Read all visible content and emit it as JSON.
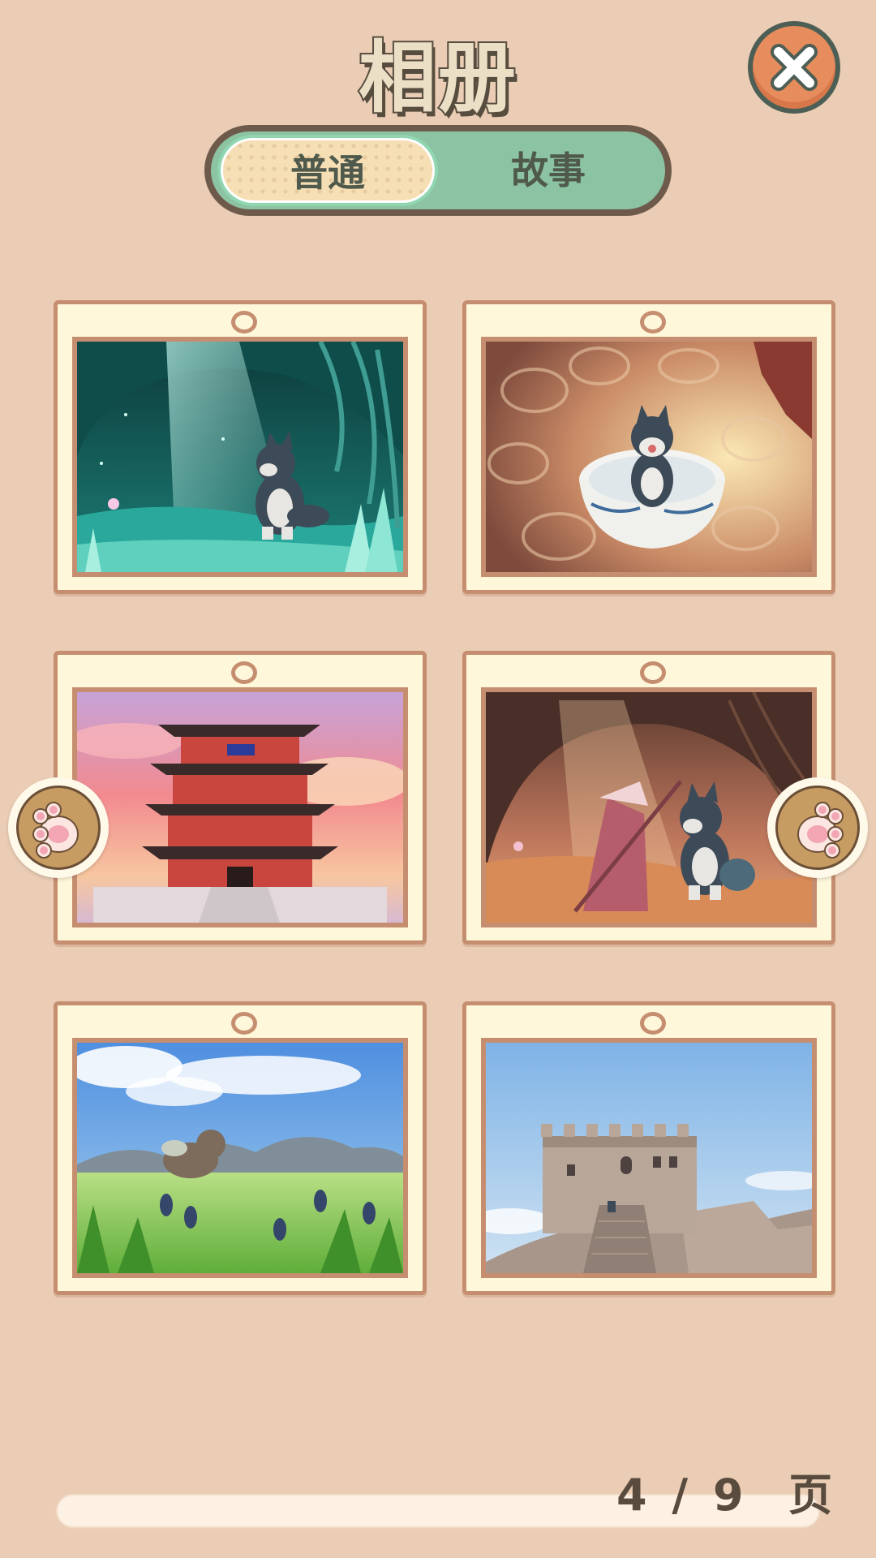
{
  "header": {
    "title": "相册"
  },
  "close_button": {
    "icon": "close-icon"
  },
  "tabs": [
    {
      "label": "普通",
      "selected": true
    },
    {
      "label": "故事",
      "selected": false
    }
  ],
  "photos": [
    {
      "scene": "cave-teal"
    },
    {
      "scene": "bowl"
    },
    {
      "scene": "pavilion"
    },
    {
      "scene": "cave-warrior"
    },
    {
      "scene": "meadow"
    },
    {
      "scene": "great-wall"
    }
  ],
  "nav": {
    "prev_icon": "paw-left-icon",
    "next_icon": "paw-right-icon"
  },
  "pagination": {
    "current": "4",
    "separator": "/",
    "total": "9",
    "unit": "页"
  },
  "colors": {
    "background": "#ebcdb5",
    "tab_bar": "#8cc3a2",
    "tab_selected": "#f6dfb5",
    "frame": "#fff7da",
    "frame_border": "#c68e70",
    "close": "#e68c5d"
  }
}
